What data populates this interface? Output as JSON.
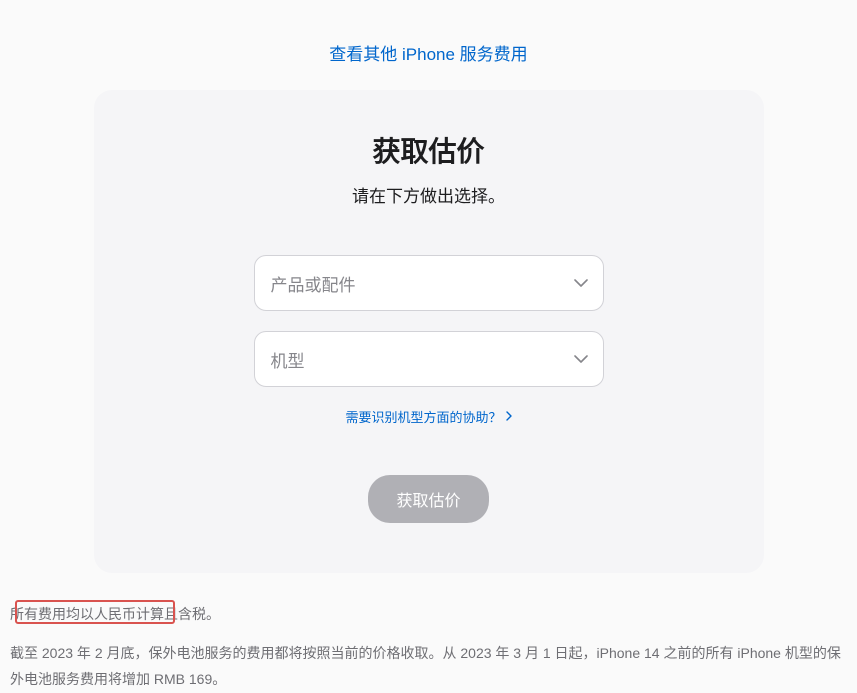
{
  "topLink": {
    "label": "查看其他 iPhone 服务费用"
  },
  "card": {
    "title": "获取估价",
    "subtitle": "请在下方做出选择。",
    "select1": {
      "placeholder": "产品或配件"
    },
    "select2": {
      "placeholder": "机型"
    },
    "helpLink": {
      "label": "需要识别机型方面的协助？"
    },
    "submit": {
      "label": "获取估价"
    }
  },
  "footer": {
    "note1": "所有费用均以人民币计算且含税。",
    "note2": "截至 2023 年 2 月底，保外电池服务的费用都将按照当前的价格收取。从 2023 年 3 月 1 日起，iPhone 14 之前的所有 iPhone 机型的保外电池服务费用将增加 RMB 169。"
  }
}
